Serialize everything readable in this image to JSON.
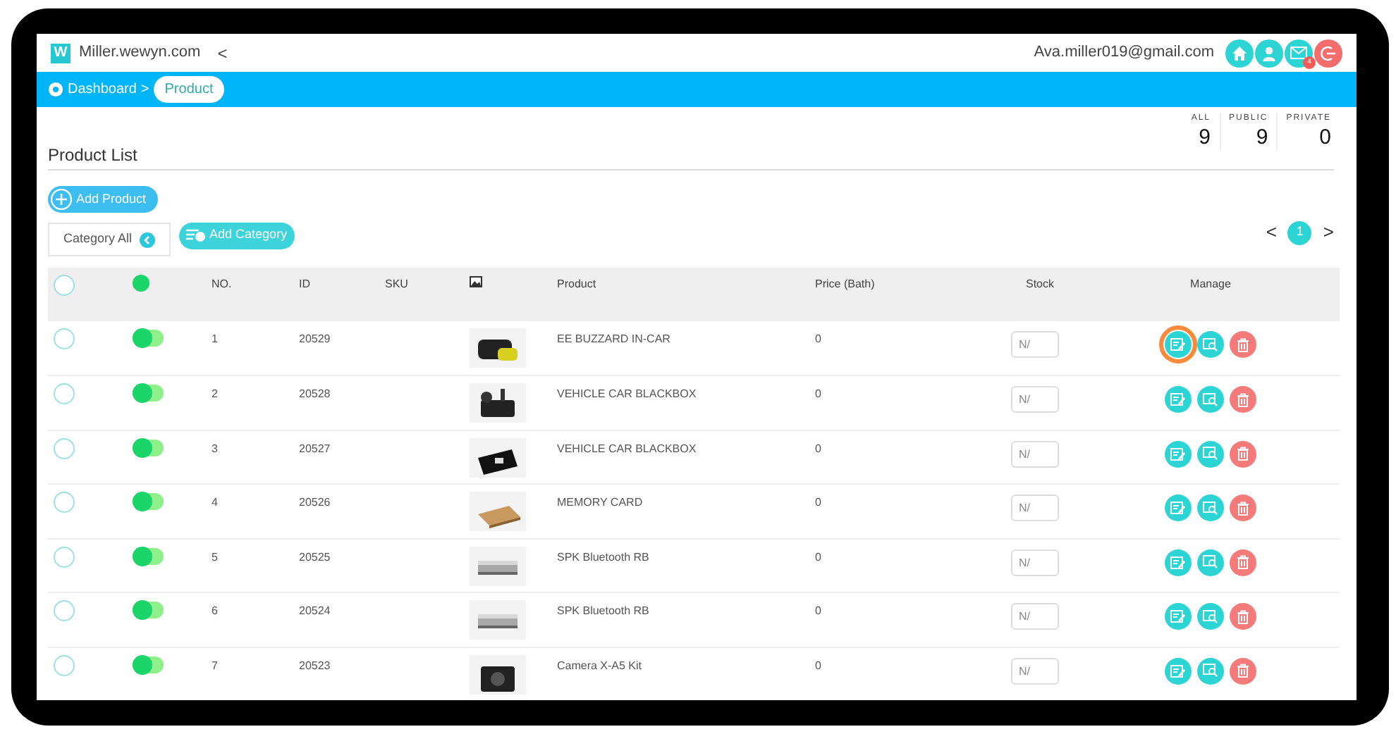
{
  "topbar": {
    "logo": "W",
    "site": "Miller.wewyn.com",
    "back": "<",
    "email": "Ava.miller019@gmail.com",
    "mail_badge": "4"
  },
  "breadcrumb": [
    {
      "label": "Dashboard",
      "selected": false
    },
    {
      "label": "Product",
      "selected": true
    }
  ],
  "breadcrumb_separator": ">",
  "stats": [
    {
      "label": "ALL",
      "value": "9"
    },
    {
      "label": "PUBLIC",
      "value": "9"
    },
    {
      "label": "PRIVATE",
      "value": "0"
    }
  ],
  "title": "Product List",
  "add_product": "Add Product",
  "category_filter": "Category All",
  "add_category": "Add Category",
  "pagination": {
    "prev": "<",
    "pages": [
      {
        "label": "1",
        "selected": true
      }
    ],
    "next": ">"
  },
  "table": {
    "all_checked": false,
    "header_toggle_on": true,
    "columns": [
      "NO.",
      "ID",
      "SKU",
      "Product",
      "Price (Bath)",
      "Stock",
      "Manage"
    ],
    "rows": [
      {
        "no": "1",
        "id": "20529",
        "product": "EE BUZZARD IN-CAR",
        "price": "0",
        "stock": "N/",
        "on": true,
        "checked": false,
        "highlighted": true
      },
      {
        "no": "2",
        "id": "20528",
        "product": "VEHICLE CAR BLACKBOX",
        "price": "0",
        "stock": "N/",
        "on": true,
        "checked": false,
        "highlighted": false
      },
      {
        "no": "3",
        "id": "20527",
        "product": "VEHICLE CAR BLACKBOX",
        "price": "0",
        "stock": "N/",
        "on": true,
        "checked": false,
        "highlighted": false
      },
      {
        "no": "4",
        "id": "20526",
        "product": "MEMORY CARD",
        "price": "0",
        "stock": "N/",
        "on": true,
        "checked": false,
        "highlighted": false
      },
      {
        "no": "5",
        "id": "20525",
        "product": "SPK Bluetooth RB",
        "price": "0",
        "stock": "N/",
        "on": true,
        "checked": false,
        "highlighted": false
      },
      {
        "no": "6",
        "id": "20524",
        "product": "SPK Bluetooth RB",
        "price": "0",
        "stock": "N/",
        "on": true,
        "checked": false,
        "highlighted": false
      },
      {
        "no": "7",
        "id": "20523",
        "product": "Camera X-A5 Kit",
        "price": "0",
        "stock": "N/",
        "on": true,
        "checked": false,
        "highlighted": false
      }
    ]
  }
}
